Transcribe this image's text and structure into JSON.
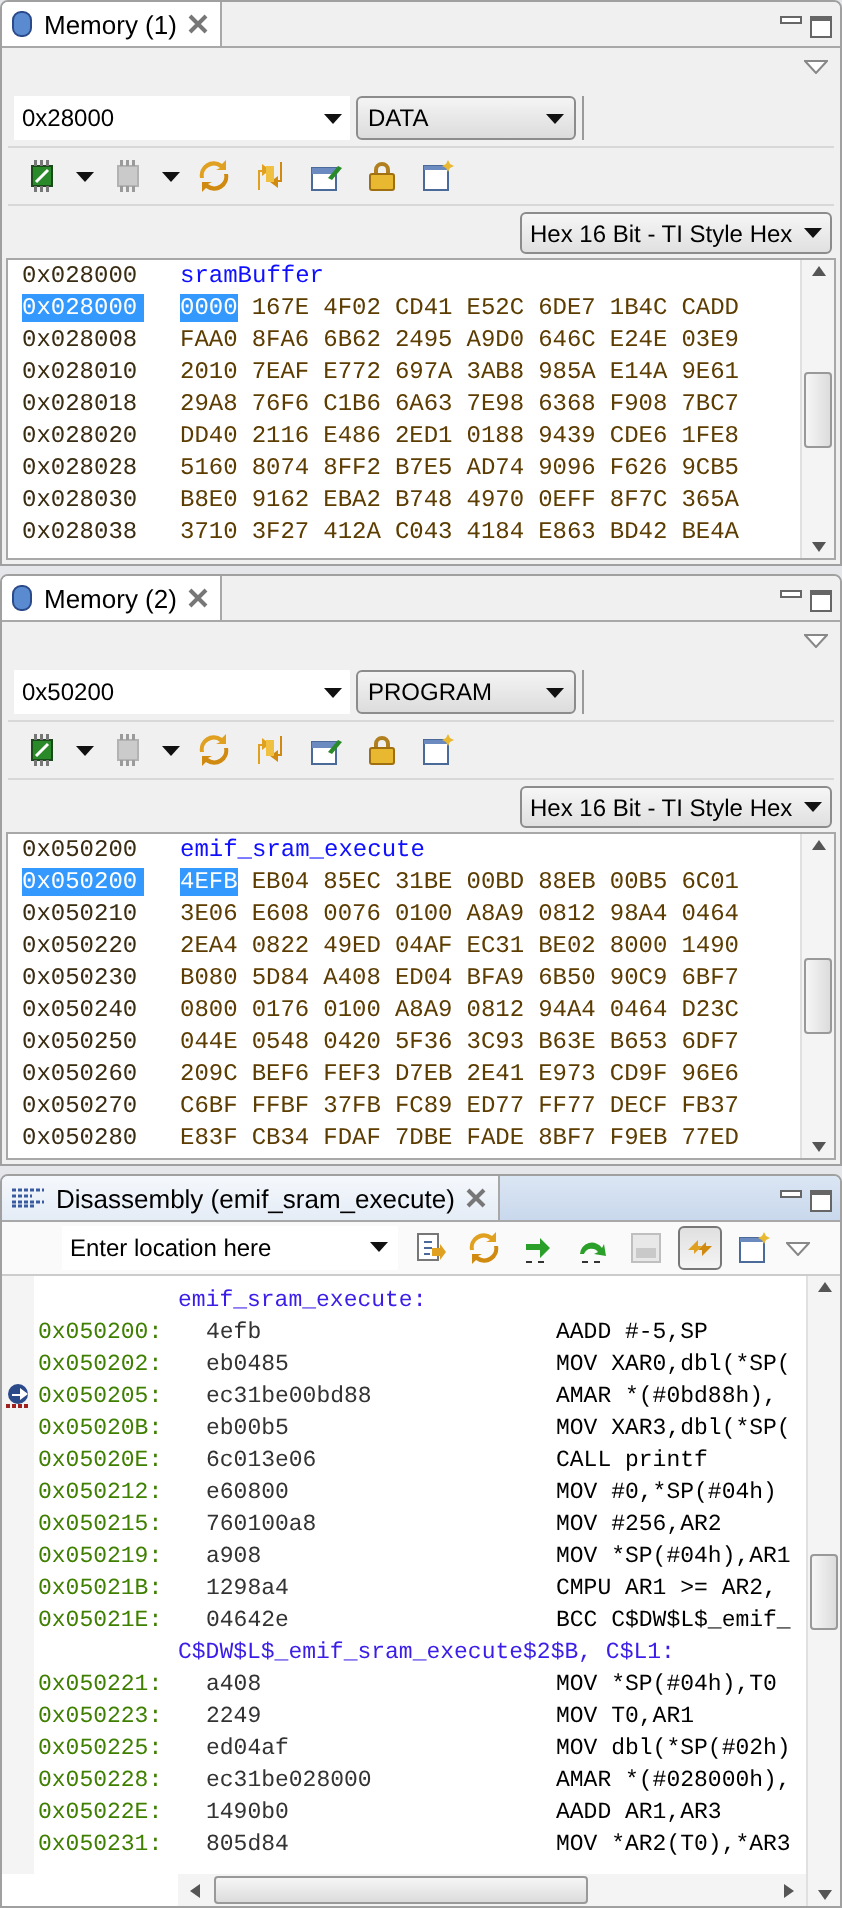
{
  "memory_views": [
    {
      "tab": {
        "title": "Memory (1)"
      },
      "address": "0x28000",
      "page": "DATA",
      "toolbar": [
        {
          "kind": "connect",
          "disabled": false
        },
        {
          "kind": "connect",
          "disabled": true
        },
        {
          "kind": "refresh",
          "disabled": false
        },
        {
          "kind": "sync",
          "disabled": false
        },
        {
          "kind": "edit",
          "disabled": false
        },
        {
          "kind": "lock",
          "disabled": false
        },
        {
          "kind": "new_view",
          "disabled": false
        }
      ],
      "format": "Hex 16 Bit - TI Style Hex",
      "lines": [
        {
          "kind": "label",
          "address": "0x028000",
          "label": "sramBuffer"
        },
        {
          "kind": "data",
          "address": "0x028000",
          "selected": true,
          "words": [
            {
              "value": "0000",
              "selected": true
            },
            {
              "value": "167E",
              "selected": false
            },
            {
              "value": "4F02",
              "selected": false
            },
            {
              "value": "CD41",
              "selected": false
            },
            {
              "value": "E52C",
              "selected": false
            },
            {
              "value": "6DE7",
              "selected": false
            },
            {
              "value": "1B4C",
              "selected": false
            },
            {
              "value": "CADD",
              "selected": false
            }
          ]
        },
        {
          "kind": "data",
          "address": "0x028008",
          "selected": false,
          "words": [
            {
              "value": "FAA0",
              "selected": false
            },
            {
              "value": "8FA6",
              "selected": false
            },
            {
              "value": "6B62",
              "selected": false
            },
            {
              "value": "2495",
              "selected": false
            },
            {
              "value": "A9D0",
              "selected": false
            },
            {
              "value": "646C",
              "selected": false
            },
            {
              "value": "E24E",
              "selected": false
            },
            {
              "value": "03E9",
              "selected": false
            }
          ]
        },
        {
          "kind": "data",
          "address": "0x028010",
          "selected": false,
          "words": [
            {
              "value": "2010",
              "selected": false
            },
            {
              "value": "7EAF",
              "selected": false
            },
            {
              "value": "E772",
              "selected": false
            },
            {
              "value": "697A",
              "selected": false
            },
            {
              "value": "3AB8",
              "selected": false
            },
            {
              "value": "985A",
              "selected": false
            },
            {
              "value": "E14A",
              "selected": false
            },
            {
              "value": "9E61",
              "selected": false
            }
          ]
        },
        {
          "kind": "data",
          "address": "0x028018",
          "selected": false,
          "words": [
            {
              "value": "29A8",
              "selected": false
            },
            {
              "value": "76F6",
              "selected": false
            },
            {
              "value": "C1B6",
              "selected": false
            },
            {
              "value": "6A63",
              "selected": false
            },
            {
              "value": "7E98",
              "selected": false
            },
            {
              "value": "6368",
              "selected": false
            },
            {
              "value": "F908",
              "selected": false
            },
            {
              "value": "7BC7",
              "selected": false
            }
          ]
        },
        {
          "kind": "data",
          "address": "0x028020",
          "selected": false,
          "words": [
            {
              "value": "DD40",
              "selected": false
            },
            {
              "value": "2116",
              "selected": false
            },
            {
              "value": "E486",
              "selected": false
            },
            {
              "value": "2ED1",
              "selected": false
            },
            {
              "value": "0188",
              "selected": false
            },
            {
              "value": "9439",
              "selected": false
            },
            {
              "value": "CDE6",
              "selected": false
            },
            {
              "value": "1FE8",
              "selected": false
            }
          ]
        },
        {
          "kind": "data",
          "address": "0x028028",
          "selected": false,
          "words": [
            {
              "value": "5160",
              "selected": false
            },
            {
              "value": "8074",
              "selected": false
            },
            {
              "value": "8FF2",
              "selected": false
            },
            {
              "value": "B7E5",
              "selected": false
            },
            {
              "value": "AD74",
              "selected": false
            },
            {
              "value": "9096",
              "selected": false
            },
            {
              "value": "F626",
              "selected": false
            },
            {
              "value": "9CB5",
              "selected": false
            }
          ]
        },
        {
          "kind": "data",
          "address": "0x028030",
          "selected": false,
          "words": [
            {
              "value": "B8E0",
              "selected": false
            },
            {
              "value": "9162",
              "selected": false
            },
            {
              "value": "EBA2",
              "selected": false
            },
            {
              "value": "B748",
              "selected": false
            },
            {
              "value": "4970",
              "selected": false
            },
            {
              "value": "0EFF",
              "selected": false
            },
            {
              "value": "8F7C",
              "selected": false
            },
            {
              "value": "365A",
              "selected": false
            }
          ]
        },
        {
          "kind": "data",
          "address": "0x028038",
          "selected": false,
          "words": [
            {
              "value": "3710",
              "selected": false
            },
            {
              "value": "3F27",
              "selected": false
            },
            {
              "value": "412A",
              "selected": false
            },
            {
              "value": "C043",
              "selected": false
            },
            {
              "value": "4184",
              "selected": false
            },
            {
              "value": "E863",
              "selected": false
            },
            {
              "value": "BD42",
              "selected": false
            },
            {
              "value": "BE4A",
              "selected": false
            }
          ]
        }
      ]
    },
    {
      "tab": {
        "title": "Memory (2)"
      },
      "address": "0x50200",
      "page": "PROGRAM",
      "toolbar": [
        {
          "kind": "connect",
          "disabled": false
        },
        {
          "kind": "connect",
          "disabled": true
        },
        {
          "kind": "refresh",
          "disabled": false
        },
        {
          "kind": "sync",
          "disabled": false
        },
        {
          "kind": "edit",
          "disabled": false
        },
        {
          "kind": "lock",
          "disabled": false
        },
        {
          "kind": "new_view",
          "disabled": false
        }
      ],
      "format": "Hex 16 Bit - TI Style Hex",
      "lines": [
        {
          "kind": "label",
          "address": "0x050200",
          "label": "emif_sram_execute"
        },
        {
          "kind": "data",
          "address": "0x050200",
          "selected": true,
          "words": [
            {
              "value": "4EFB",
              "selected": true
            },
            {
              "value": "EB04",
              "selected": false
            },
            {
              "value": "85EC",
              "selected": false
            },
            {
              "value": "31BE",
              "selected": false
            },
            {
              "value": "00BD",
              "selected": false
            },
            {
              "value": "88EB",
              "selected": false
            },
            {
              "value": "00B5",
              "selected": false
            },
            {
              "value": "6C01",
              "selected": false
            }
          ]
        },
        {
          "kind": "data",
          "address": "0x050210",
          "selected": false,
          "words": [
            {
              "value": "3E06",
              "selected": false
            },
            {
              "value": "E608",
              "selected": false
            },
            {
              "value": "0076",
              "selected": false
            },
            {
              "value": "0100",
              "selected": false
            },
            {
              "value": "A8A9",
              "selected": false
            },
            {
              "value": "0812",
              "selected": false
            },
            {
              "value": "98A4",
              "selected": false
            },
            {
              "value": "0464",
              "selected": false
            }
          ]
        },
        {
          "kind": "data",
          "address": "0x050220",
          "selected": false,
          "words": [
            {
              "value": "2EA4",
              "selected": false
            },
            {
              "value": "0822",
              "selected": false
            },
            {
              "value": "49ED",
              "selected": false
            },
            {
              "value": "04AF",
              "selected": false
            },
            {
              "value": "EC31",
              "selected": false
            },
            {
              "value": "BE02",
              "selected": false
            },
            {
              "value": "8000",
              "selected": false
            },
            {
              "value": "1490",
              "selected": false
            }
          ]
        },
        {
          "kind": "data",
          "address": "0x050230",
          "selected": false,
          "words": [
            {
              "value": "B080",
              "selected": false
            },
            {
              "value": "5D84",
              "selected": false
            },
            {
              "value": "A408",
              "selected": false
            },
            {
              "value": "ED04",
              "selected": false
            },
            {
              "value": "BFA9",
              "selected": false
            },
            {
              "value": "6B50",
              "selected": false
            },
            {
              "value": "90C9",
              "selected": false
            },
            {
              "value": "6BF7",
              "selected": false
            }
          ]
        },
        {
          "kind": "data",
          "address": "0x050240",
          "selected": false,
          "words": [
            {
              "value": "0800",
              "selected": false
            },
            {
              "value": "0176",
              "selected": false
            },
            {
              "value": "0100",
              "selected": false
            },
            {
              "value": "A8A9",
              "selected": false
            },
            {
              "value": "0812",
              "selected": false
            },
            {
              "value": "94A4",
              "selected": false
            },
            {
              "value": "0464",
              "selected": false
            },
            {
              "value": "D23C",
              "selected": false
            }
          ]
        },
        {
          "kind": "data",
          "address": "0x050250",
          "selected": false,
          "words": [
            {
              "value": "044E",
              "selected": false
            },
            {
              "value": "0548",
              "selected": false
            },
            {
              "value": "0420",
              "selected": false
            },
            {
              "value": "5F36",
              "selected": false
            },
            {
              "value": "3C93",
              "selected": false
            },
            {
              "value": "B63E",
              "selected": false
            },
            {
              "value": "B653",
              "selected": false
            },
            {
              "value": "6DF7",
              "selected": false
            }
          ]
        },
        {
          "kind": "data",
          "address": "0x050260",
          "selected": false,
          "words": [
            {
              "value": "209C",
              "selected": false
            },
            {
              "value": "BEF6",
              "selected": false
            },
            {
              "value": "FEF3",
              "selected": false
            },
            {
              "value": "D7EB",
              "selected": false
            },
            {
              "value": "2E41",
              "selected": false
            },
            {
              "value": "E973",
              "selected": false
            },
            {
              "value": "CD9F",
              "selected": false
            },
            {
              "value": "96E6",
              "selected": false
            }
          ]
        },
        {
          "kind": "data",
          "address": "0x050270",
          "selected": false,
          "words": [
            {
              "value": "C6BF",
              "selected": false
            },
            {
              "value": "FFBF",
              "selected": false
            },
            {
              "value": "37FB",
              "selected": false
            },
            {
              "value": "FC89",
              "selected": false
            },
            {
              "value": "ED77",
              "selected": false
            },
            {
              "value": "FF77",
              "selected": false
            },
            {
              "value": "DECF",
              "selected": false
            },
            {
              "value": "FB37",
              "selected": false
            }
          ]
        },
        {
          "kind": "data",
          "address": "0x050280",
          "selected": false,
          "words": [
            {
              "value": "E83F",
              "selected": false
            },
            {
              "value": "CB34",
              "selected": false
            },
            {
              "value": "FDAF",
              "selected": false
            },
            {
              "value": "7DBE",
              "selected": false
            },
            {
              "value": "FADE",
              "selected": false
            },
            {
              "value": "8BF7",
              "selected": false
            },
            {
              "value": "F9EB",
              "selected": false
            },
            {
              "value": "77ED",
              "selected": false
            }
          ]
        }
      ]
    }
  ],
  "disassembly": {
    "tab": {
      "title": "Disassembly (emif_sram_execute)"
    },
    "location": {
      "placeholder": "Enter location here"
    },
    "toolbar": [
      {
        "kind": "go",
        "disabled": false,
        "pressed": false
      },
      {
        "kind": "refresh",
        "disabled": false,
        "pressed": false
      },
      {
        "kind": "step_into",
        "disabled": false,
        "pressed": false
      },
      {
        "kind": "step_over",
        "disabled": false,
        "pressed": false
      },
      {
        "kind": "numbers",
        "disabled": true,
        "pressed": false
      },
      {
        "kind": "link",
        "disabled": false,
        "pressed": true
      },
      {
        "kind": "new_view",
        "disabled": false,
        "pressed": false
      }
    ],
    "lines": [
      {
        "kind": "label",
        "text": "emif_sram_execute:"
      },
      {
        "kind": "instruction",
        "address": "0x050200:",
        "opcode": "4efb",
        "mnemonic": "AADD #-5,SP",
        "current": false
      },
      {
        "kind": "instruction",
        "address": "0x050202:",
        "opcode": "eb0485",
        "mnemonic": "MOV XAR0,dbl(*SP(",
        "current": false
      },
      {
        "kind": "instruction",
        "address": "0x050205:",
        "opcode": "ec31be00bd88",
        "mnemonic": "AMAR *(#0bd88h),",
        "current": true
      },
      {
        "kind": "instruction",
        "address": "0x05020B:",
        "opcode": "eb00b5",
        "mnemonic": "MOV XAR3,dbl(*SP(",
        "current": false
      },
      {
        "kind": "instruction",
        "address": "0x05020E:",
        "opcode": "6c013e06",
        "mnemonic": "CALL printf",
        "current": false
      },
      {
        "kind": "instruction",
        "address": "0x050212:",
        "opcode": "e60800",
        "mnemonic": "MOV #0,*SP(#04h)",
        "current": false
      },
      {
        "kind": "instruction",
        "address": "0x050215:",
        "opcode": "760100a8",
        "mnemonic": "MOV #256,AR2",
        "current": false
      },
      {
        "kind": "instruction",
        "address": "0x050219:",
        "opcode": "a908",
        "mnemonic": "MOV *SP(#04h),AR1",
        "current": false
      },
      {
        "kind": "instruction",
        "address": "0x05021B:",
        "opcode": "1298a4",
        "mnemonic": "CMPU AR1 >= AR2,",
        "current": false
      },
      {
        "kind": "instruction",
        "address": "0x05021E:",
        "opcode": "04642e",
        "mnemonic": "BCC C$DW$L$_emif_",
        "current": false
      },
      {
        "kind": "label",
        "text": "C$DW$L$_emif_sram_execute$2$B, C$L1:"
      },
      {
        "kind": "instruction",
        "address": "0x050221:",
        "opcode": "a408",
        "mnemonic": "MOV *SP(#04h),T0",
        "current": false
      },
      {
        "kind": "instruction",
        "address": "0x050223:",
        "opcode": "2249",
        "mnemonic": "MOV T0,AR1",
        "current": false
      },
      {
        "kind": "instruction",
        "address": "0x050225:",
        "opcode": "ed04af",
        "mnemonic": "MOV dbl(*SP(#02h)",
        "current": false
      },
      {
        "kind": "instruction",
        "address": "0x050228:",
        "opcode": "ec31be028000",
        "mnemonic": "AMAR *(#028000h),",
        "current": false
      },
      {
        "kind": "instruction",
        "address": "0x05022E:",
        "opcode": "1490b0",
        "mnemonic": "AADD AR1,AR3",
        "current": false
      },
      {
        "kind": "instruction",
        "address": "0x050231:",
        "opcode": "805d84",
        "mnemonic": "MOV *AR2(T0),*AR3",
        "current": false
      }
    ]
  }
}
